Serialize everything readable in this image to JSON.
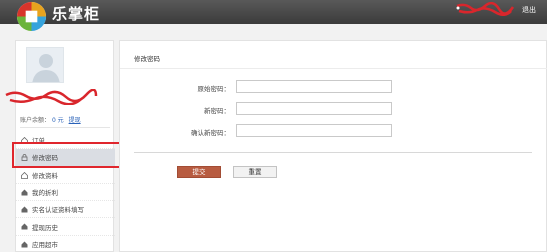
{
  "header": {
    "brand": "乐掌柜",
    "logout_label": "退出"
  },
  "sidebar": {
    "balance_label": "账户余额：",
    "balance_amount": "0 元",
    "withdraw_link": "提现",
    "items": [
      {
        "label": "订单",
        "icon": "order-icon"
      },
      {
        "label": "修改密码",
        "icon": "lock-icon",
        "active": true
      },
      {
        "label": "修改资料",
        "icon": "edit-icon"
      },
      {
        "label": "我的折利",
        "icon": "home-icon"
      },
      {
        "label": "实名认证资料填写",
        "icon": "home-icon"
      },
      {
        "label": "提现历史",
        "icon": "home-icon"
      },
      {
        "label": "应用超市",
        "icon": "home-icon"
      }
    ]
  },
  "main": {
    "page_title": "修改密码",
    "fields": [
      {
        "label": "原始密码：",
        "value": ""
      },
      {
        "label": "新密码：",
        "value": ""
      },
      {
        "label": "确认新密码：",
        "value": ""
      }
    ],
    "submit_label": "提交",
    "reset_label": "重置"
  },
  "colors": {
    "topbar": "#4a4a4a",
    "highlight": "#e0262d",
    "submit": "#b85c41",
    "link": "#2a62b8"
  }
}
